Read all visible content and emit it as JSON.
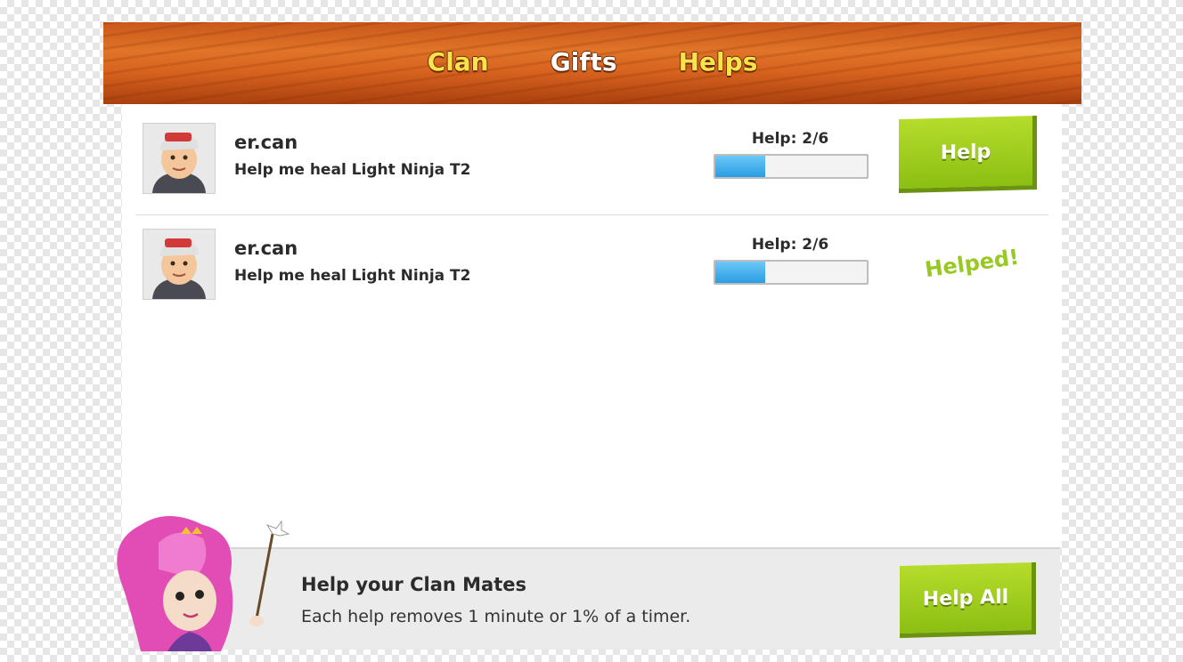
{
  "header": {
    "tabs": [
      {
        "label": "Clan",
        "active": false
      },
      {
        "label": "Gifts",
        "active": false
      },
      {
        "label": "Helps",
        "active": true
      }
    ]
  },
  "requests": [
    {
      "name": "er.can",
      "message": "Help me heal Light Ninja T2",
      "help_text": "Help: 2/6",
      "progress": 0.33,
      "action_label": "Help",
      "status": ""
    },
    {
      "name": "er.can",
      "message": "Help me heal Light Ninja T2",
      "help_text": "Help: 2/6",
      "progress": 0.33,
      "action_label": "",
      "status": "Helped!"
    }
  ],
  "footer": {
    "title": "Help your Clan Mates",
    "description": "Each help removes 1 minute or 1% of a timer.",
    "help_all_label": "Help All"
  },
  "colors": {
    "tab_active": "#f8e34a",
    "button_green": "#9ccb1c",
    "progress_blue": "#2a9de3",
    "helped_green": "#98c922"
  }
}
